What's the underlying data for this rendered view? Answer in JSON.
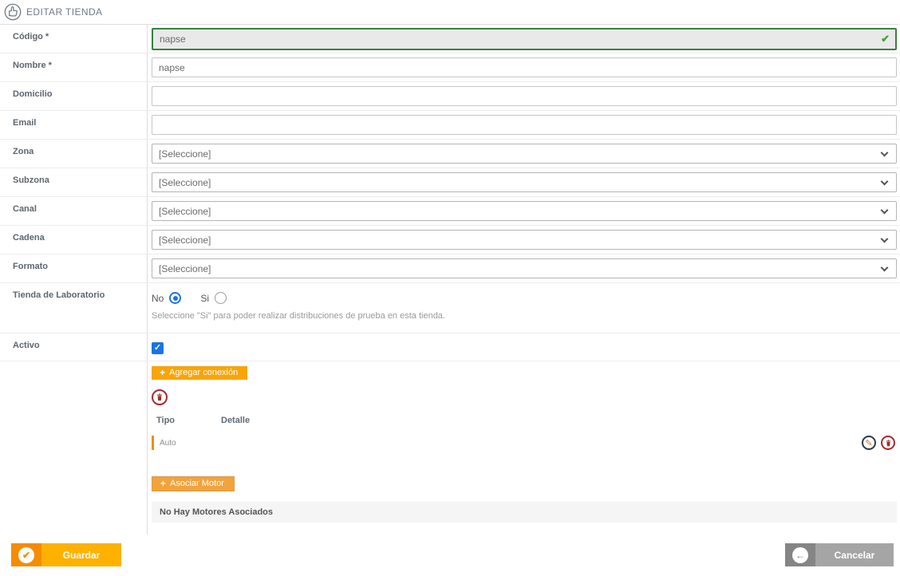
{
  "header": {
    "title": "EDITAR TIENDA",
    "icon": "thumbs-up-icon"
  },
  "form": {
    "fields": [
      {
        "label": "Código *",
        "type": "text",
        "value": "napse",
        "valid": true
      },
      {
        "label": "Nombre *",
        "type": "text",
        "value": "napse"
      },
      {
        "label": "Domicilio",
        "type": "text",
        "value": ""
      },
      {
        "label": "Email",
        "type": "text",
        "value": ""
      },
      {
        "label": "Zona",
        "type": "select",
        "value": "[Seleccione]"
      },
      {
        "label": "Subzona",
        "type": "select",
        "value": "[Seleccione]"
      },
      {
        "label": "Canal",
        "type": "select",
        "value": "[Seleccione]"
      },
      {
        "label": "Cadena",
        "type": "select",
        "value": "[Seleccione]"
      },
      {
        "label": "Formato",
        "type": "select",
        "value": "[Seleccione]"
      }
    ],
    "laboratorio": {
      "label": "Tienda de Laboratorio",
      "option_no": "No",
      "option_si": "Si",
      "selected": "No",
      "help": "Seleccione \"Si\" para poder realizar distribuciones de prueba en esta tienda."
    },
    "activo": {
      "label": "Activo",
      "checked": true
    }
  },
  "connections": {
    "add_button_label": "Agregar conexión",
    "columns": {
      "tipo": "Tipo",
      "detalle": "Detalle"
    },
    "rows": [
      {
        "tipo": "Auto",
        "detalle": ""
      }
    ]
  },
  "motors": {
    "add_button_label": "Asociar Motor",
    "empty_message": "No Hay Motores Asociados"
  },
  "footer": {
    "save_label": "Guardar",
    "cancel_label": "Cancelar"
  },
  "icons": {
    "plus": "+",
    "check": "✔",
    "checkbox_check": "✓",
    "pencil": "✎",
    "arrow_left": "←"
  },
  "colors": {
    "accent_orange": "#f9a408",
    "orange_dark": "#f68c00",
    "orange_light": "#ffb100",
    "valid_green": "#37813c",
    "check_green": "#3fa43f",
    "delete_red": "#a62b2b",
    "select_blue": "#1a73e8",
    "gray_dark": "#858585",
    "gray_light": "#a5a5a5"
  }
}
